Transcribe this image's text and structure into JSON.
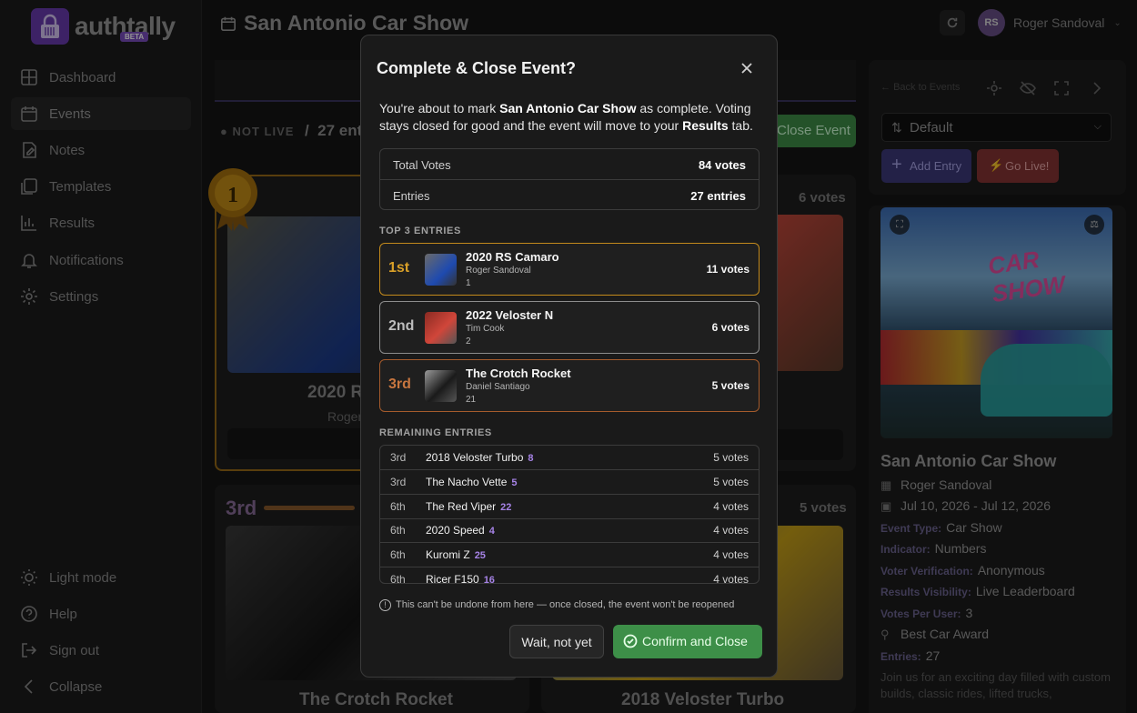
{
  "app": {
    "name": "authtally",
    "badge": "BETA"
  },
  "sidebar": {
    "items": [
      {
        "label": "Dashboard",
        "icon": "grid-icon"
      },
      {
        "label": "Events",
        "icon": "calendar-icon"
      },
      {
        "label": "Notes",
        "icon": "note-icon"
      },
      {
        "label": "Templates",
        "icon": "templates-icon"
      },
      {
        "label": "Results",
        "icon": "bar-chart-icon"
      },
      {
        "label": "Notifications",
        "icon": "bell-icon"
      },
      {
        "label": "Settings",
        "icon": "gear-icon"
      }
    ],
    "bottom": [
      {
        "label": "Light mode",
        "icon": "sun-icon"
      },
      {
        "label": "Help",
        "icon": "help-icon"
      },
      {
        "label": "Sign out",
        "icon": "sign-out-icon"
      },
      {
        "label": "Collapse",
        "icon": "chevron-left-icon"
      }
    ]
  },
  "header": {
    "title": "San Antonio Car Show",
    "user": {
      "initials": "RS",
      "name": "Roger Sandoval"
    }
  },
  "main": {
    "status": "NOT LIVE",
    "entries_count": "27 ent",
    "close_event_label": "Close Event",
    "cards": [
      {
        "rank": "1st",
        "name": "2020 R",
        "owner": "Roger"
      },
      {
        "votes": "6 votes"
      },
      {
        "rank": "3rd",
        "name": "The Crotch Rocket"
      },
      {
        "votes": "5 votes",
        "name": "2018 Veloster Turbo"
      }
    ]
  },
  "right_panel": {
    "back_label": "Back to Events",
    "sort_value": "Default",
    "add_entry_label": "Add Entry",
    "go_live_label": "Go Live!",
    "event": {
      "title": "San Antonio Car Show",
      "image_text": "CAR SHOW",
      "organizer": "Roger Sandoval",
      "dates": "Jul 10, 2026 - Jul 12, 2026",
      "event_type_k": "Event Type:",
      "event_type_v": "Car Show",
      "indicator_k": "Indicator:",
      "indicator_v": "Numbers",
      "voter_k": "Voter Verification:",
      "voter_v": "Anonymous",
      "results_k": "Results Visibility:",
      "results_v": "Live Leaderboard",
      "votes_k": "Votes Per User:",
      "votes_v": "3",
      "award": "Best Car Award",
      "entries_k": "Entries:",
      "entries_v": "27",
      "description": "Join us for an exciting day filled with custom builds, classic rides, lifted trucks,"
    }
  },
  "modal": {
    "title": "Complete & Close Event?",
    "intro_pre": "You're about to mark ",
    "intro_event": "San Antonio Car Show",
    "intro_mid": " as complete. Voting stays closed for good and the event will move to your ",
    "intro_tab": "Results",
    "intro_post": " tab.",
    "total_votes_label": "Total Votes",
    "total_votes_value": "84 votes",
    "entries_label": "Entries",
    "entries_value": "27 entries",
    "top3_label": "TOP 3 ENTRIES",
    "top3": [
      {
        "rank": "1st",
        "name": "2020 RS Camaro",
        "owner": "Roger Sandoval",
        "number": "1",
        "votes": "11 votes"
      },
      {
        "rank": "2nd",
        "name": "2022 Veloster N",
        "owner": "Tim Cook",
        "number": "2",
        "votes": "6 votes"
      },
      {
        "rank": "3rd",
        "name": "The Crotch Rocket",
        "owner": "Daniel Santiago",
        "number": "21",
        "votes": "5 votes"
      }
    ],
    "remaining_label": "REMAINING ENTRIES",
    "remaining": [
      {
        "rank": "3rd",
        "name": "2018 Veloster Turbo",
        "number": "8",
        "votes": "5 votes"
      },
      {
        "rank": "3rd",
        "name": "The Nacho Vette",
        "number": "5",
        "votes": "5 votes"
      },
      {
        "rank": "6th",
        "name": "The Red Viper",
        "number": "22",
        "votes": "4 votes"
      },
      {
        "rank": "6th",
        "name": "2020 Speed",
        "number": "4",
        "votes": "4 votes"
      },
      {
        "rank": "6th",
        "name": "Kuromi Z",
        "number": "25",
        "votes": "4 votes"
      },
      {
        "rank": "6th",
        "name": "Ricer F150",
        "number": "16",
        "votes": "4 votes"
      }
    ],
    "warning": "This can't be undone from here — once closed, the event won't be reopened",
    "cancel_label": "Wait, not yet",
    "confirm_label": "Confirm and Close"
  },
  "colors": {
    "accent": "#6a3bb0",
    "gold": "#c38a1c",
    "silver": "#8d8d8d",
    "bronze": "#a55b2c",
    "confirm": "#3d8f48"
  }
}
